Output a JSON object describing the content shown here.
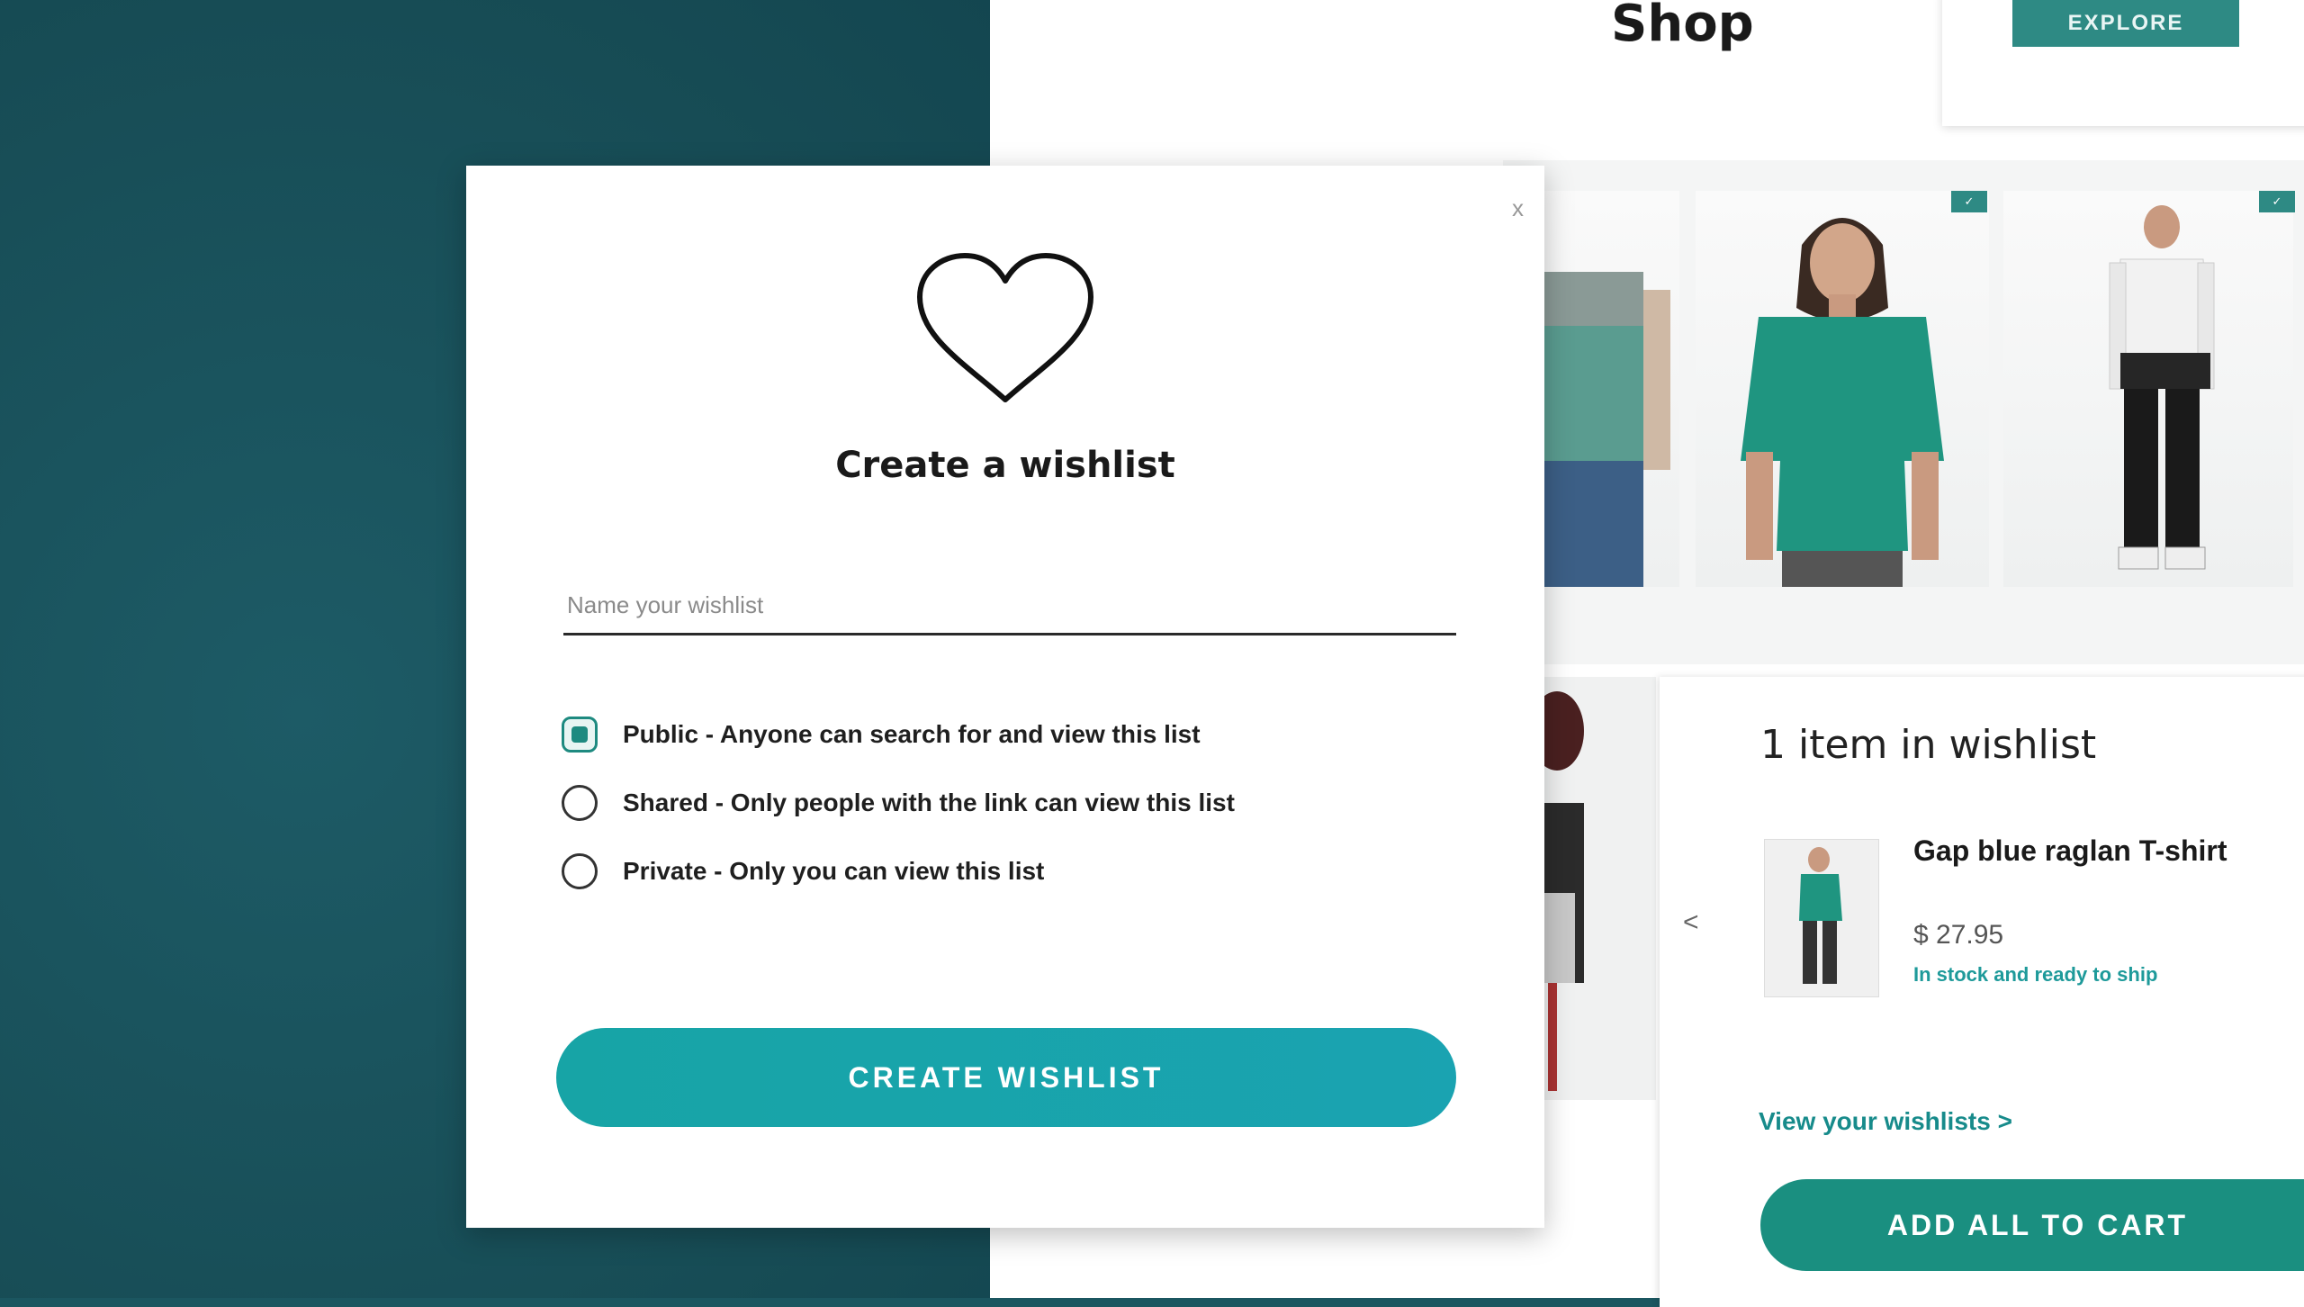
{
  "shop": {
    "title": "Shop",
    "top_button_label": "EXPLORE"
  },
  "modal": {
    "title": "Create a wishlist",
    "name_placeholder": "Name your wishlist",
    "options": [
      {
        "label": "Public - Anyone can search for and view this list",
        "checked": true
      },
      {
        "label": "Shared - Only people with the link can view this list",
        "checked": false
      },
      {
        "label": "Private - Only you can view this list",
        "checked": false
      }
    ],
    "create_button": "CREATE WISHLIST",
    "close_label": "x"
  },
  "wishlist_panel": {
    "title": "1 item in wishlist",
    "item": {
      "name": "Gap blue raglan T-shirt",
      "price": "$ 27.95",
      "status": "In stock and ready to ship"
    },
    "side_arrow": "<",
    "view_link": "View your wishlists >",
    "add_all_button": "ADD ALL TO CART"
  },
  "colors": {
    "background": "#1b5660",
    "accent": "#17a4a6",
    "accent_dark": "#1a8f80"
  },
  "icons": [
    "heart-icon",
    "close-icon",
    "chevron-left-icon"
  ]
}
